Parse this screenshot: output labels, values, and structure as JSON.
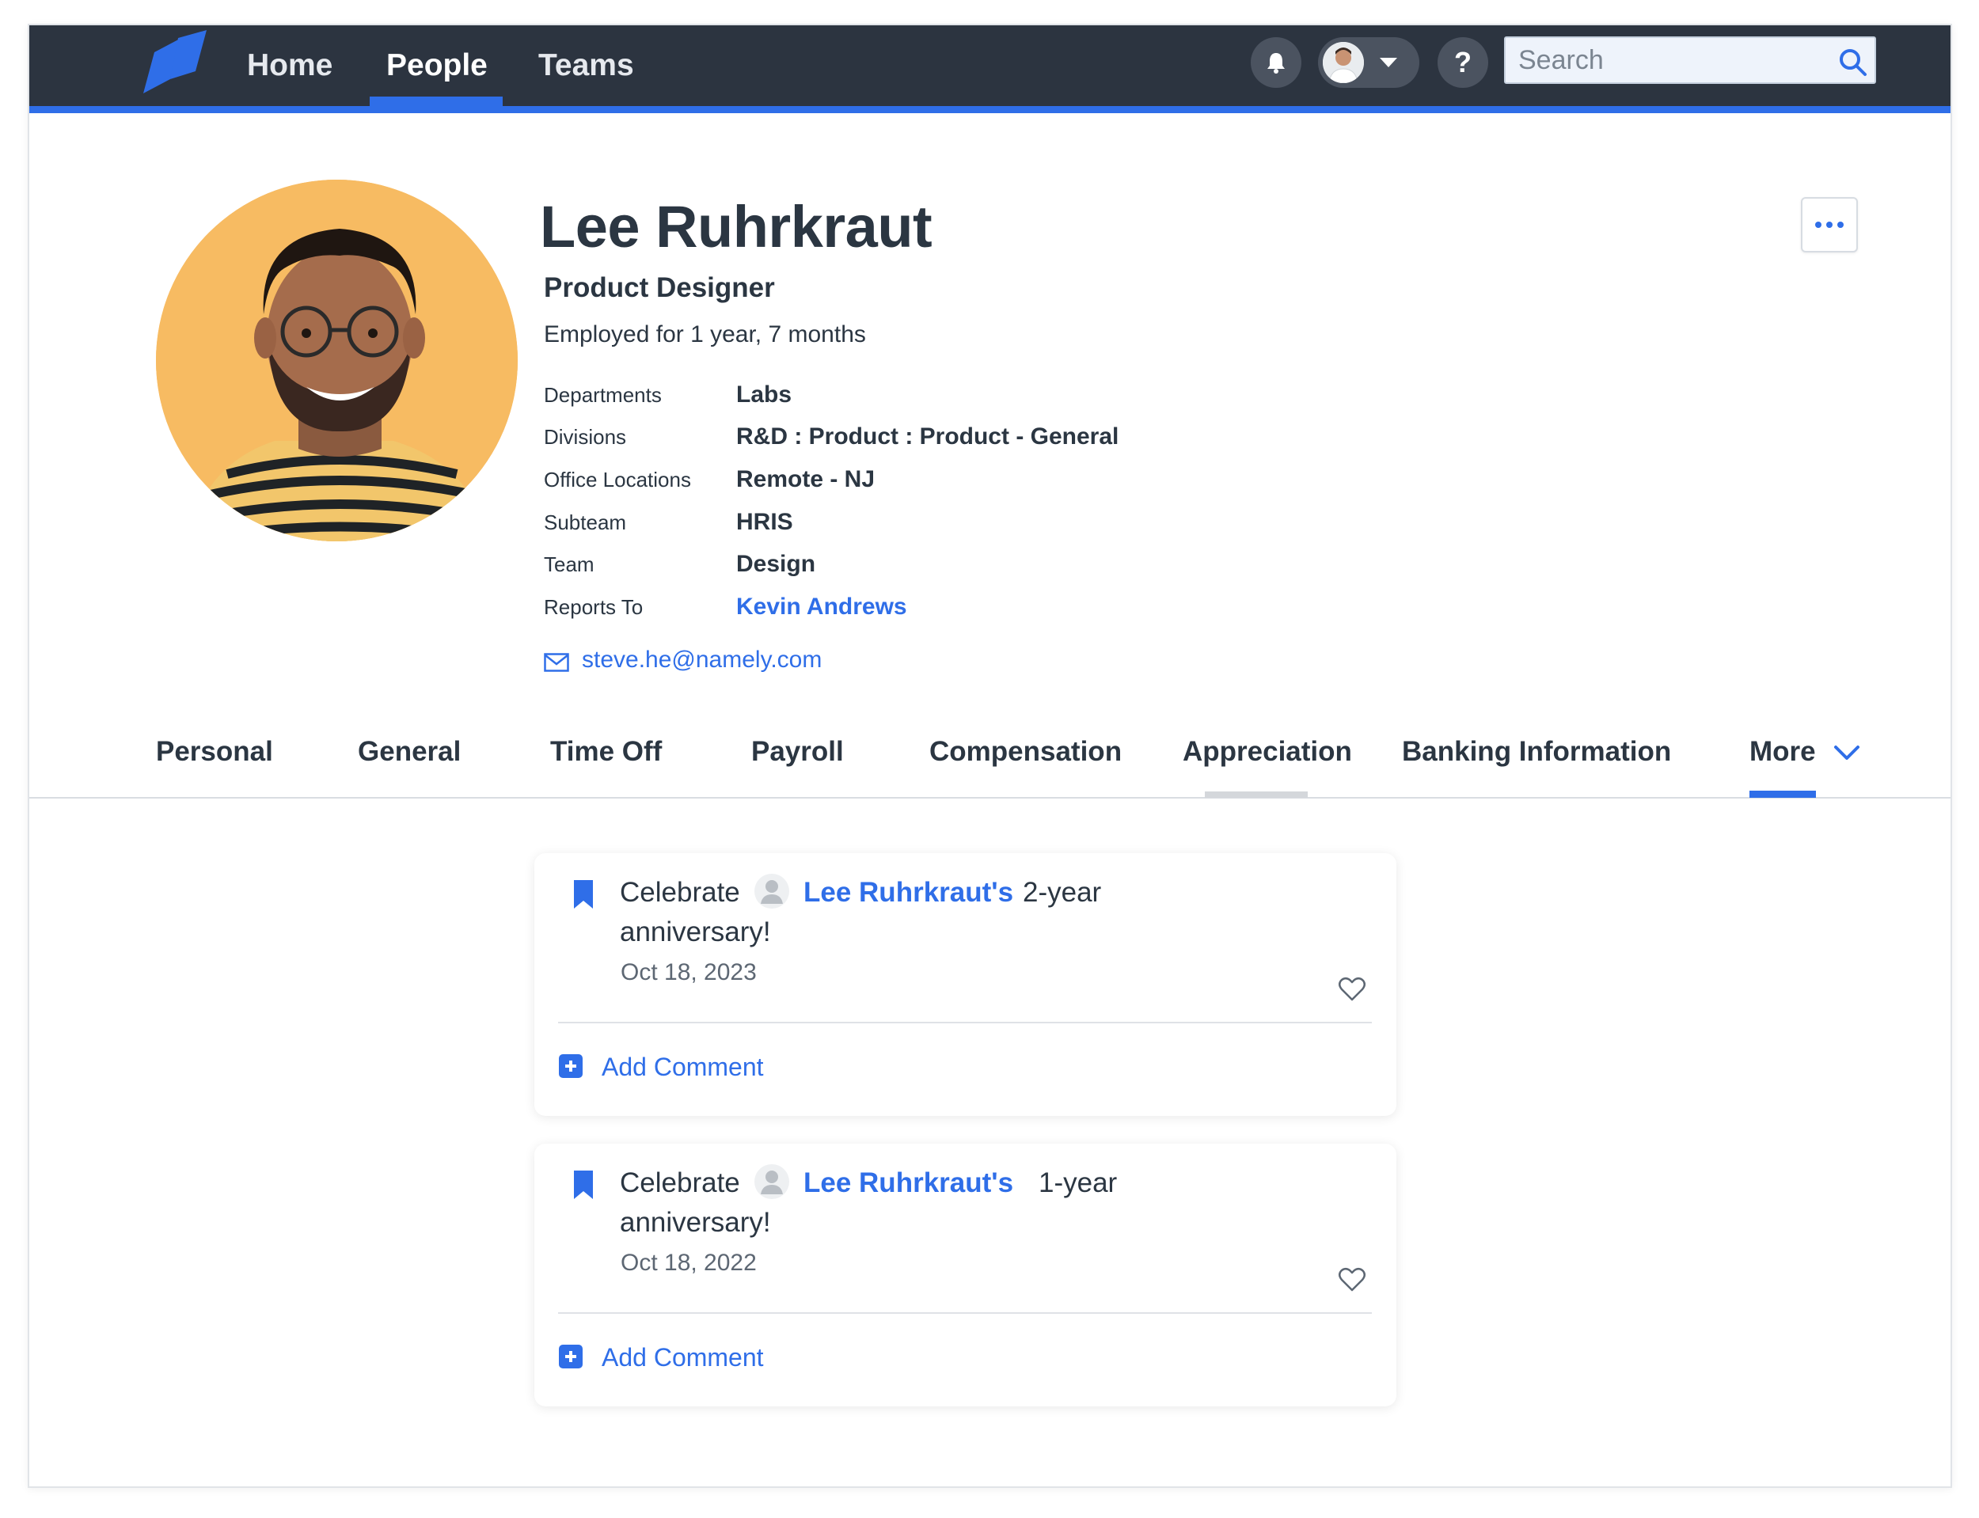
{
  "nav": {
    "items": [
      "Home",
      "People",
      "Teams"
    ],
    "active": "People",
    "search_placeholder": "Search",
    "help_label": "?"
  },
  "profile": {
    "name": "Lee Ruhrkraut",
    "title": "Product Designer",
    "tenure": "Employed for 1 year, 7 months",
    "details": [
      {
        "label": "Departments",
        "value": "Labs"
      },
      {
        "label": "Divisions",
        "value": "R&D : Product : Product - General"
      },
      {
        "label": "Office Locations",
        "value": "Remote - NJ"
      },
      {
        "label": "Subteam",
        "value": "HRIS"
      },
      {
        "label": "Team",
        "value": "Design"
      },
      {
        "label": "Reports To",
        "value": "Kevin Andrews"
      }
    ],
    "email": "steve.he@namely.com"
  },
  "tabs": [
    "Personal",
    "General",
    "Time Off",
    "Payroll",
    "Compensation",
    "Appreciation",
    "Banking Information",
    "More"
  ],
  "active_tab": "More",
  "cards": [
    {
      "prefix": "Celebrate",
      "person": "Lee Ruhrkraut's",
      "suffix": "2-year",
      "line2": "anniversary!",
      "date": "Oct 18, 2023",
      "add_comment": "Add Comment"
    },
    {
      "prefix": "Celebrate",
      "person": "Lee Ruhrkraut's",
      "suffix": "1-year",
      "line2": "anniversary!",
      "date": "Oct 18, 2022",
      "add_comment": "Add Comment"
    }
  ],
  "colors": {
    "topbar": "#2c3440",
    "accent": "#2f6ee8",
    "avatar_bg": "#f7bb62",
    "text": "#2b3642"
  }
}
